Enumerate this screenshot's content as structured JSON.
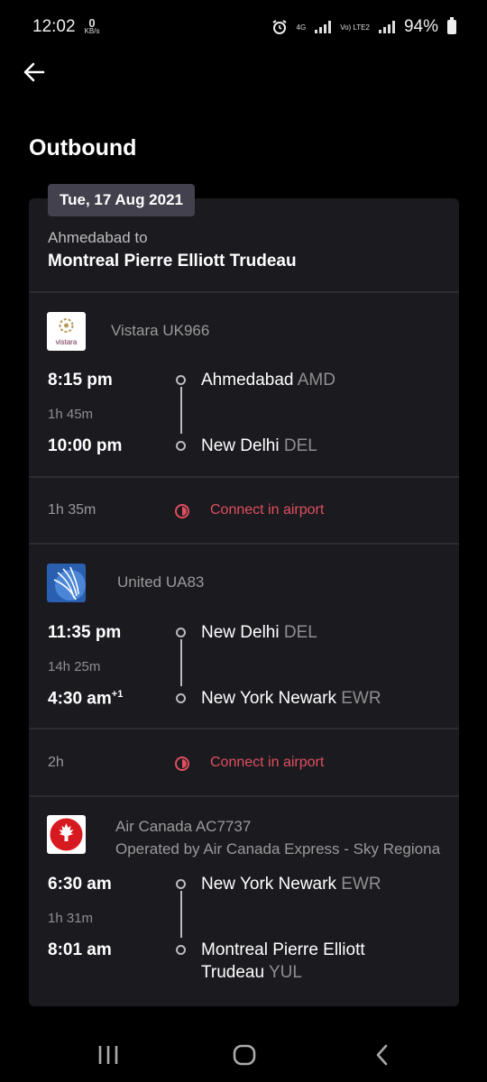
{
  "status_bar": {
    "time": "12:02",
    "net_speed": "0",
    "net_unit": "KB/s",
    "net_type": "4G",
    "lte": "Vo) LTE2",
    "battery": "94%"
  },
  "page": {
    "title": "Outbound"
  },
  "trip": {
    "date": "Tue, 17 Aug 2021",
    "from_label": "Ahmedabad to",
    "to_label": "Montreal Pierre Elliott Trudeau"
  },
  "segments": [
    {
      "airline": "Vistara UK966",
      "logo_text": "vistara",
      "dep_time": "8:15 pm",
      "duration": "1h 45m",
      "arr_time": "10:00 pm",
      "arr_day_offset": "",
      "dep_place": "Ahmedabad",
      "dep_code": "AMD",
      "arr_place": "New Delhi",
      "arr_code": "DEL"
    },
    {
      "airline": "United UA83",
      "dep_time": "11:35 pm",
      "duration": "14h 25m",
      "arr_time": "4:30 am",
      "arr_day_offset": "+1",
      "dep_place": "New Delhi",
      "dep_code": "DEL",
      "arr_place": "New York Newark",
      "arr_code": "EWR"
    },
    {
      "airline": "Air Canada AC7737",
      "operated_by": "Operated by Air Canada Express - Sky Regiona",
      "dep_time": "6:30 am",
      "duration": "1h 31m",
      "arr_time": "8:01 am",
      "arr_day_offset": "",
      "dep_place": "New York Newark",
      "dep_code": "EWR",
      "arr_place_line1": "Montreal Pierre Elliott",
      "arr_place_line2": "Trudeau",
      "arr_code": "YUL"
    }
  ],
  "layovers": [
    {
      "duration": "1h 35m",
      "text": "Connect in airport"
    },
    {
      "duration": "2h",
      "text": "Connect in airport"
    }
  ],
  "colors": {
    "background": "#000000",
    "card": "#1b1a1f",
    "badge": "#42414d",
    "connect": "#e04f5f"
  },
  "icons": [
    "back-arrow-icon",
    "clock-icon",
    "recent-apps-icon",
    "home-icon",
    "nav-back-icon"
  ]
}
